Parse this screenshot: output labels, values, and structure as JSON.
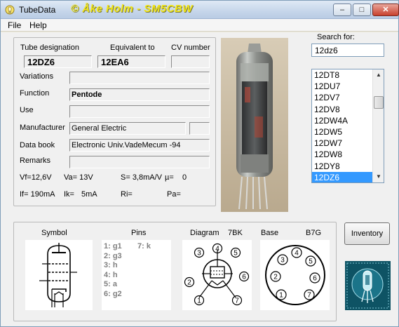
{
  "window": {
    "title": "TubeData",
    "banner": "© Åke Holm - SM5CBW",
    "minimize": "–",
    "maximize": "□",
    "close": "✕"
  },
  "menu": {
    "file": "File",
    "help": "Help"
  },
  "fields": {
    "tube_designation_label": "Tube designation",
    "tube_designation": "12DZ6",
    "equivalent_label": "Equivalent to",
    "equivalent": "12EA6",
    "cv_label": "CV number",
    "cv": "",
    "variations_label": "Variations",
    "variations": "",
    "function_label": "Function",
    "function": "Pentode",
    "use_label": "Use",
    "use": "",
    "manufacturer_label": "Manufacturer",
    "manufacturer": "General Electric",
    "manufacturer_extra": "",
    "databook_label": "Data book",
    "databook": "Electronic Univ.VadeMecum -94",
    "remarks_label": "Remarks",
    "remarks": ""
  },
  "params": {
    "vf": "Vf=12,6V",
    "va": "Va= 13V",
    "s": "S= 3,8mA/V",
    "mu": "µ=",
    "mu_val": "0",
    "if": "If= 190mA",
    "ik": "Ik=",
    "ik_val": "5mA",
    "ri": "Ri=",
    "pa": "Pa="
  },
  "search": {
    "label": "Search for:",
    "value": "12dz6"
  },
  "tube_list": [
    "12DT8",
    "12DU7",
    "12DV7",
    "12DV8",
    "12DW4A",
    "12DW5",
    "12DW7",
    "12DW8",
    "12DY8",
    "12DZ6"
  ],
  "selected_tube": "12DZ6",
  "lower": {
    "symbol_label": "Symbol",
    "pins_label": "Pins",
    "diagram_label": "Diagram",
    "diagram_code": "7BK",
    "base_label": "Base",
    "base_code": "B7G",
    "pins_col1": [
      "1: g1",
      "2: g3",
      "3: h",
      "4: h",
      "5: a",
      "6: g2"
    ],
    "pins_col2": [
      "7: k"
    ],
    "diagram_pins": [
      "1",
      "2",
      "3",
      "4",
      "5",
      "6",
      "7"
    ]
  },
  "buttons": {
    "inventory": "Inventory"
  },
  "colors": {
    "selection": "#3399ff",
    "banner": "#f2e61a",
    "pin_text": "#808080"
  }
}
